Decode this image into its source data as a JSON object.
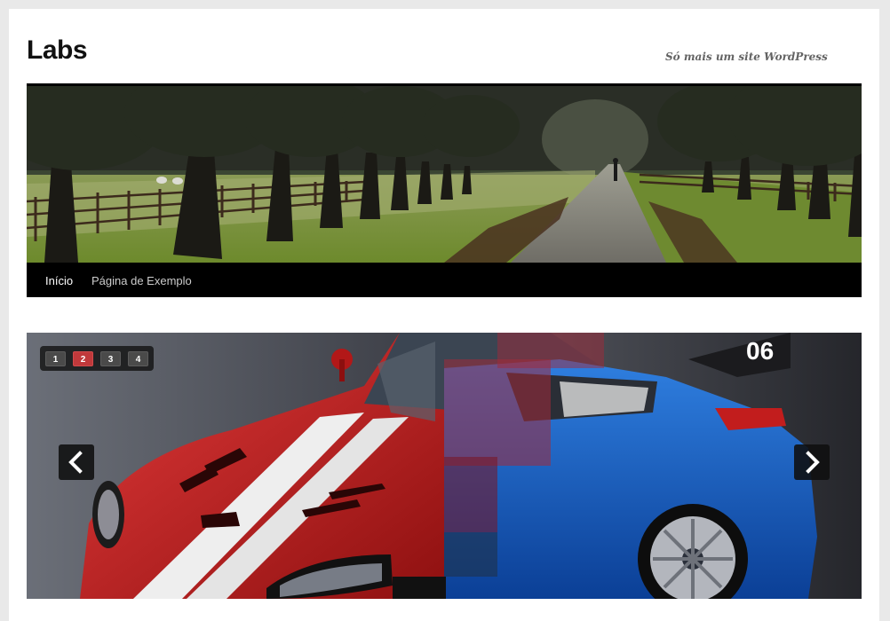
{
  "site": {
    "title": "Labs",
    "description": "Só mais um site WordPress"
  },
  "header_image": {
    "icon": "tree-lined-road-image"
  },
  "menu": {
    "items": [
      {
        "label": "Início",
        "current": true
      },
      {
        "label": "Página de Exemplo",
        "current": false
      }
    ]
  },
  "slider": {
    "pager": [
      "1",
      "2",
      "3",
      "4"
    ],
    "active_index": 1,
    "prev_icon": "chevron-left-icon",
    "next_icon": "chevron-right-icon",
    "accent_color": "#c0393b"
  }
}
